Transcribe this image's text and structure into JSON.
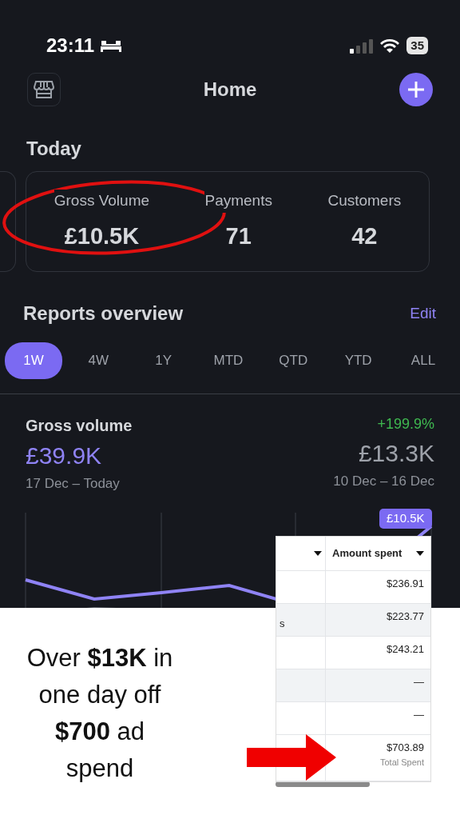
{
  "status_bar": {
    "time": "23:11",
    "battery": "35"
  },
  "header": {
    "title": "Home"
  },
  "today": {
    "title": "Today",
    "stats": [
      {
        "label": "Gross Volume",
        "value": "£10.5K"
      },
      {
        "label": "Payments",
        "value": "71"
      },
      {
        "label": "Customers",
        "value": "42"
      }
    ]
  },
  "reports": {
    "title": "Reports overview",
    "edit": "Edit",
    "periods": [
      {
        "label": "1W",
        "selected": true
      },
      {
        "label": "4W",
        "selected": false
      },
      {
        "label": "1Y",
        "selected": false
      },
      {
        "label": "MTD",
        "selected": false
      },
      {
        "label": "QTD",
        "selected": false
      },
      {
        "label": "YTD",
        "selected": false
      },
      {
        "label": "ALL",
        "selected": false
      }
    ]
  },
  "gross_volume": {
    "title": "Gross volume",
    "value": "£39.9K",
    "range": "17 Dec – Today",
    "change": "+199.9%",
    "previous_value": "£13.3K",
    "previous_range": "10 Dec – 16 Dec",
    "tooltip": "£10.5K"
  },
  "spend_table": {
    "column_2": "Amount spent",
    "rows": [
      {
        "column_1": "",
        "amount": "$236.91"
      },
      {
        "column_1": "s",
        "amount": "$223.77"
      },
      {
        "column_1": "",
        "amount": "$243.21"
      },
      {
        "column_1": "",
        "amount": "—"
      },
      {
        "column_1": "",
        "amount": "—"
      }
    ],
    "total": "$703.89",
    "total_label": "Total Spent"
  },
  "caption": "Over **$13K** in one day off **$700** ad spend"
}
